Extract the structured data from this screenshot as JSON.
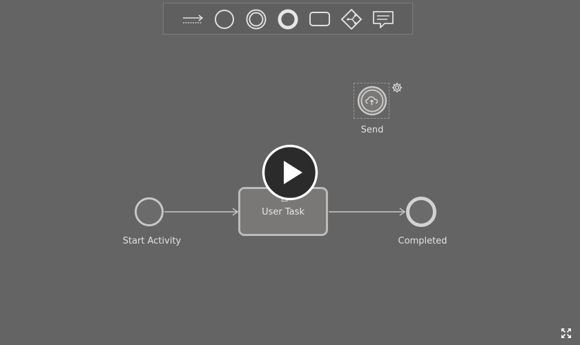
{
  "palette": {
    "tools": [
      {
        "icon": "sequence-flow-icon"
      },
      {
        "icon": "start-event-icon"
      },
      {
        "icon": "intermediate-event-icon"
      },
      {
        "icon": "end-event-icon"
      },
      {
        "icon": "task-icon"
      },
      {
        "icon": "gateway-icon"
      },
      {
        "icon": "annotation-icon"
      }
    ]
  },
  "diagram": {
    "start_event": {
      "label": "Start Activity"
    },
    "user_task": {
      "label": "User Task"
    },
    "end_event": {
      "label": "Completed"
    },
    "send_event": {
      "label": "Send"
    }
  },
  "colors": {
    "canvas": "#646464",
    "stroke": "#c8c8c8",
    "task_fill": "#7a7876",
    "play_button": "#2b2b2b"
  }
}
